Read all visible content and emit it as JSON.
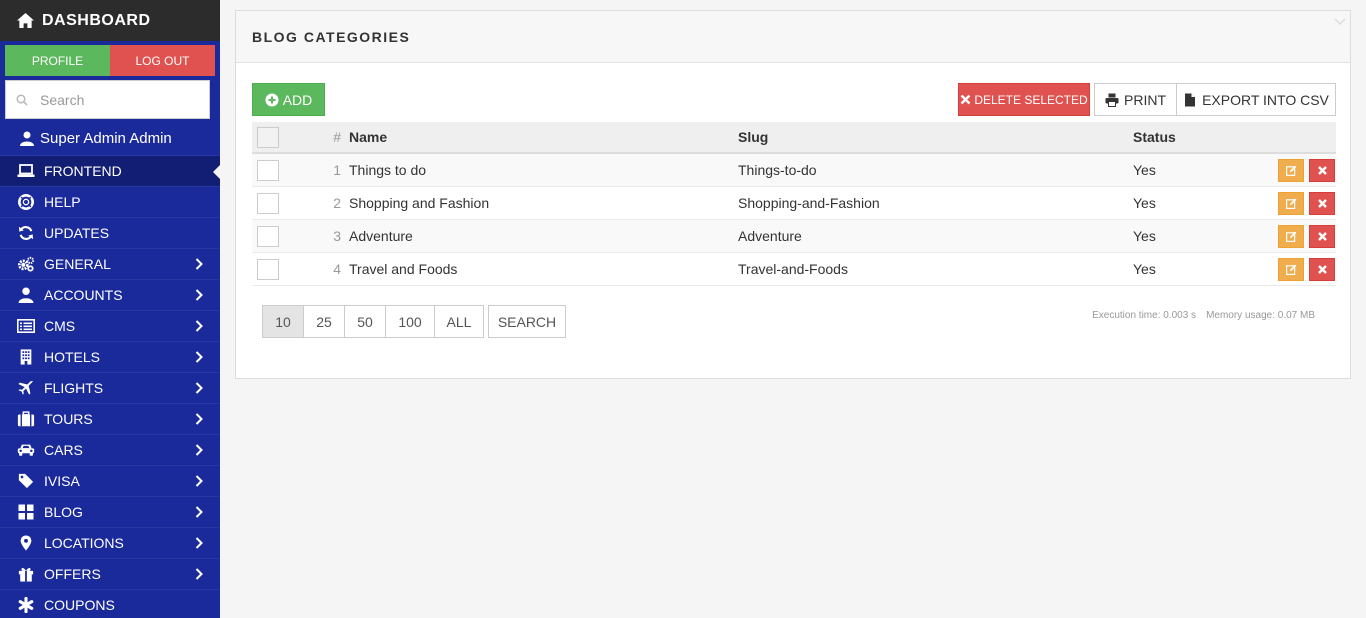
{
  "sidebar": {
    "brand": "DASHBOARD",
    "profile_label": "PROFILE",
    "logout_label": "LOG OUT",
    "search_placeholder": "Search",
    "user_name": "Super Admin Admin",
    "items": [
      {
        "label": "FRONTEND",
        "icon": "laptop-icon",
        "has_submenu": false,
        "active": true
      },
      {
        "label": "HELP",
        "icon": "life-ring-icon",
        "has_submenu": false
      },
      {
        "label": "UPDATES",
        "icon": "refresh-icon",
        "has_submenu": false
      },
      {
        "label": "GENERAL",
        "icon": "gears-icon",
        "has_submenu": true
      },
      {
        "label": "ACCOUNTS",
        "icon": "user-icon",
        "has_submenu": true
      },
      {
        "label": "CMS",
        "icon": "list-alt-icon",
        "has_submenu": true
      },
      {
        "label": "HOTELS",
        "icon": "building-icon",
        "has_submenu": true
      },
      {
        "label": "FLIGHTS",
        "icon": "plane-icon",
        "has_submenu": true
      },
      {
        "label": "TOURS",
        "icon": "suitcase-icon",
        "has_submenu": true
      },
      {
        "label": "CARS",
        "icon": "car-icon",
        "has_submenu": true
      },
      {
        "label": "IVISA",
        "icon": "tag-icon",
        "has_submenu": true
      },
      {
        "label": "BLOG",
        "icon": "th-large-icon",
        "has_submenu": true
      },
      {
        "label": "LOCATIONS",
        "icon": "map-marker-icon",
        "has_submenu": true
      },
      {
        "label": "OFFERS",
        "icon": "gift-icon",
        "has_submenu": true
      },
      {
        "label": "COUPONS",
        "icon": "asterisk-icon",
        "has_submenu": false
      }
    ]
  },
  "panel": {
    "title": "BLOG CATEGORIES",
    "toolbar": {
      "add_label": "ADD",
      "delete_label": "DELETE SELECTED",
      "print_label": "PRINT",
      "export_label": "EXPORT INTO CSV"
    },
    "table": {
      "columns": {
        "num": "#",
        "name": "Name",
        "slug": "Slug",
        "status": "Status"
      },
      "rows": [
        {
          "num": "1",
          "name": "Things to do",
          "slug": "Things-to-do",
          "status": "Yes"
        },
        {
          "num": "2",
          "name": "Shopping and Fashion",
          "slug": "Shopping-and-Fashion",
          "status": "Yes"
        },
        {
          "num": "3",
          "name": "Adventure",
          "slug": "Adventure",
          "status": "Yes"
        },
        {
          "num": "4",
          "name": "Travel and Foods",
          "slug": "Travel-and-Foods",
          "status": "Yes"
        }
      ]
    },
    "pager": {
      "sizes": [
        "10",
        "25",
        "50",
        "100",
        "ALL"
      ],
      "active": "10",
      "search_label": "SEARCH"
    },
    "stats": {
      "execution_time": "Execution time: 0.003 s",
      "memory_usage": "Memory usage: 0.07 MB"
    }
  },
  "colors": {
    "sidebar_bg": "#1b2a9a",
    "brand_bg": "#2c2c2c",
    "success": "#5cb85c",
    "danger": "#e0524f",
    "warning": "#f0ad4e"
  }
}
